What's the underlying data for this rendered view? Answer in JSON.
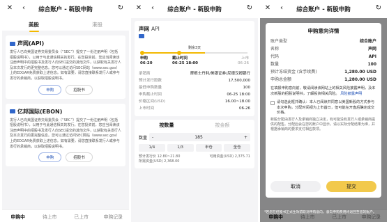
{
  "window_title": "综合账户 - 新股申购",
  "panel1": {
    "tabs": [
      "美股",
      "港股"
    ],
    "cards": [
      {
        "name": "声网(API)",
        "desc": "发行人已向美国证券交易委员会（“SEC”）提交了一份注册声明（包括招股说明书），以用于与此通信相关的发行。在您投资前，您应当阅读该注册声明中的招股书及发行人向SEC提交的其他文件，以获取有关发行人及本次发行的更完整信息。您可以通过访问SEC网站（www.sec.gov）上的EDGAR免费获取上述信息。如有需要，请您直接联系发行人或参与发行的承销商，以获取招股说明书。",
        "btn_primary": "申购",
        "btn_secondary": "招股书"
      },
      {
        "name": "亿邦国际(EBON)",
        "desc": "发行人已向美国证券交易委员会（“SEC”）提交了一份注册声明（包括招股说明书），以用于与此通信相关的发行。在您投资前，您应当阅读该注册声明中的招股书及发行人向SEC提交的其他文件，以获取有关发行人及本次发行的更完整信息。您可以通过访问SEC网站（www.sec.gov）上的EDGAR免费获取上述信息。如有需要，请您直接联系发行人或参与发行的承销商，以获取招股说明书。",
        "btn_primary": "申购",
        "btn_secondary": "招股书"
      }
    ],
    "bottom_tabs": [
      "申购中",
      "待上市",
      "已上市",
      "申购记录"
    ]
  },
  "panel2": {
    "name": "声网",
    "code": "API",
    "countdown": "剩余3天",
    "timeline": [
      {
        "label": "申购",
        "date": "06-20"
      },
      {
        "label": "截止时间",
        "date": "06-25 18:00"
      },
      {
        "label": "上市",
        "date": "06-26"
      }
    ],
    "progress": 0.6,
    "info": [
      {
        "k": "承销商",
        "v": "摩根士丹利/美银证券/尼德汉姆银行"
      },
      {
        "k": "预计发行股数",
        "v": "17,500,000"
      },
      {
        "k": "最低申购数量",
        "v": "100"
      },
      {
        "k": "申购截止时间",
        "v": "06-25 18:00"
      },
      {
        "k": "价格区间(USD)",
        "v": "16.00~18.00"
      },
      {
        "k": "上市时间",
        "v": "06-26"
      }
    ],
    "seg_tabs": [
      "按数量",
      "按金额"
    ],
    "qty_label": "数量",
    "qty_value": "185",
    "minus": "-",
    "plus": "+",
    "fractions": [
      "1/4",
      "1/3",
      "半仓",
      "全仓"
    ],
    "summary_left": "预计发行价 12.80~21.80",
    "summary_right": "可用资金(USD) 2,375.71",
    "summary_left2": "所需资金(USD) 2,368.00"
  },
  "panel3": {
    "modal_title": "申购意向详情",
    "rows": [
      {
        "k": "账户类型",
        "v": "综合账户"
      },
      {
        "k": "名称",
        "v": "声网"
      },
      {
        "k": "代码",
        "v": "API"
      },
      {
        "k": "数量",
        "v": "100"
      },
      {
        "k": "预计冻结资金 (含手续费)",
        "v": "1,280.00 USD"
      },
      {
        "k": "申购总金额",
        "v": "1,280.00 USD"
      }
    ],
    "warn": "在填报申购意向前，敬请阅读该网站上的相关风险披露声明，及本次新股的招股说明书，了解投资相关风险。",
    "warn_link": "风险披露声明",
    "check": "请勾选此框并确认：本人已阅读并同意以美国新股的方式参与本次申购，分配时间视为上市首日，但可能在开盘后确定成交价格。",
    "note": "新股分配由发行人及承销商独立决定，有可能没有发行人或承销商提供的配售。分配后会在您的账户中显示，请以实际分配结果为准，并根据承销商的要求支付相应款项。",
    "cancel": "取消",
    "submit": "提交",
    "footnote": "*若您在招股书正式生效前取消申购意向，意向申购费用将退回至您的账户。",
    "bottom_tabs": [
      "申购中",
      "待上市",
      "已上市",
      "申购记录"
    ]
  }
}
